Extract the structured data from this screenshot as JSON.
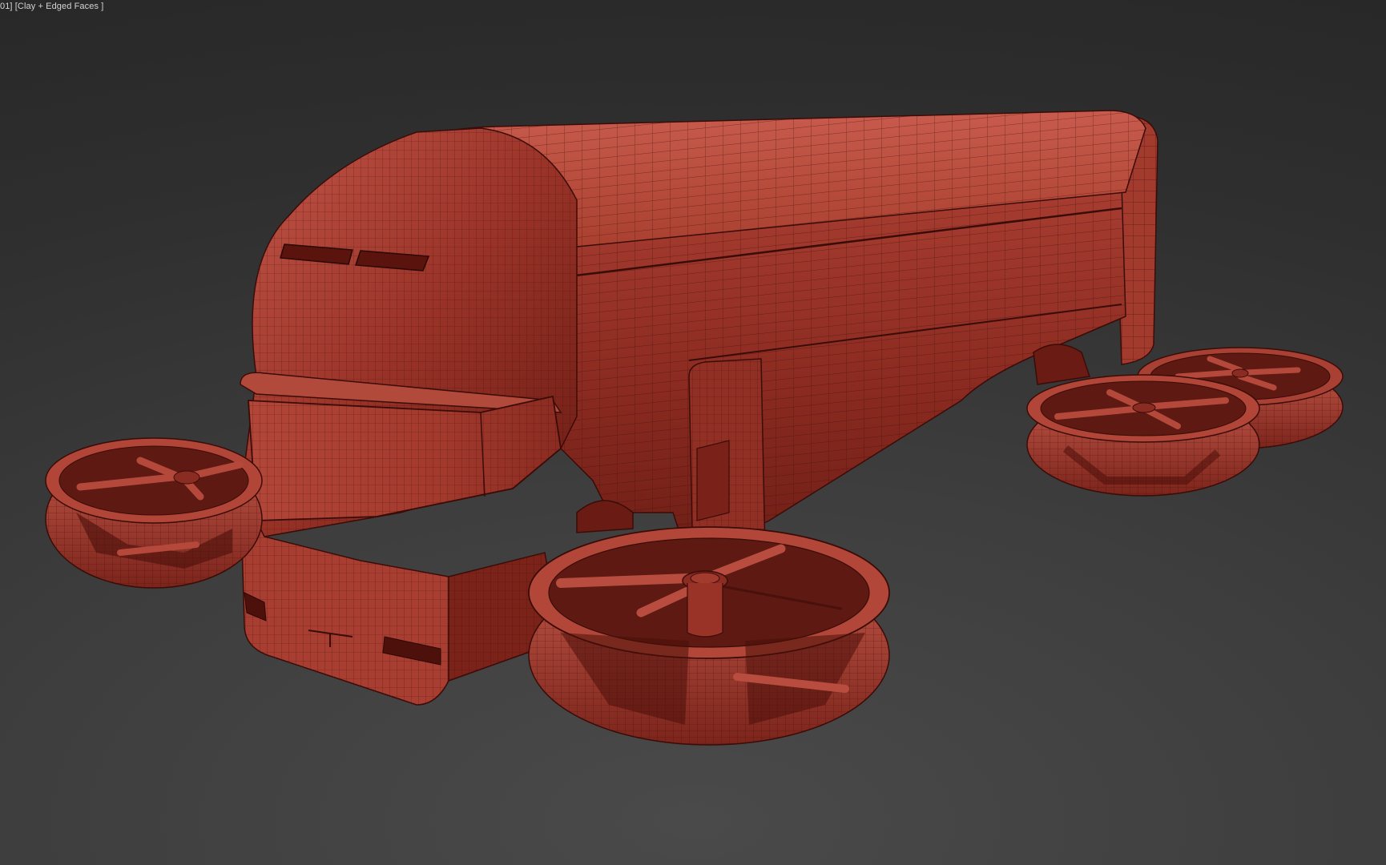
{
  "viewport": {
    "label": "01] [Clay + Edged Faces ]",
    "shading_mode": "Clay + Edged Faces",
    "background_color": "#3a3a3a"
  },
  "model": {
    "clay_color": "#b5463a",
    "clay_shadow_color": "#6e2018",
    "edge_color": "#3a0c08"
  }
}
